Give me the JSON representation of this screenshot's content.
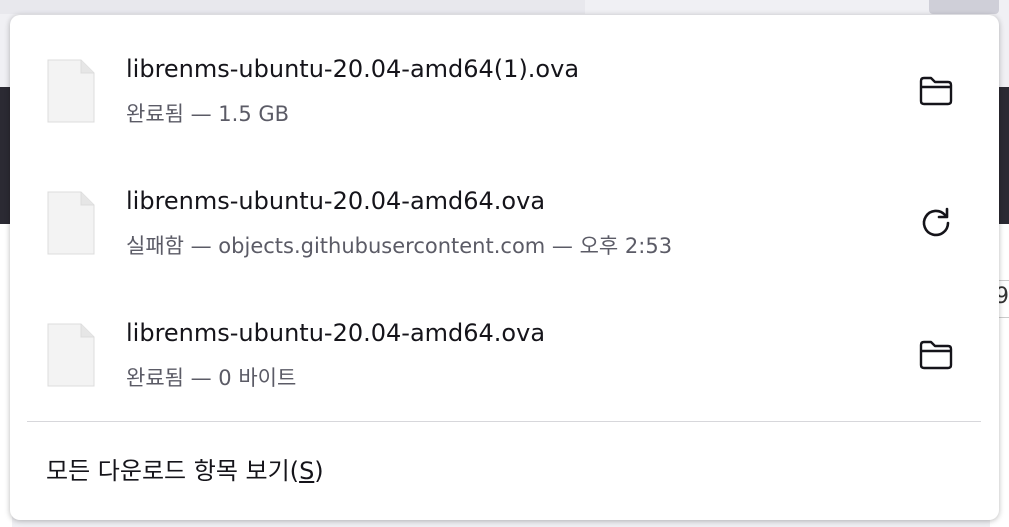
{
  "downloads": {
    "items": [
      {
        "filename": "librenms-ubuntu-20.04-amd64(1).ova",
        "status": "완료됨 — 1.5 GB",
        "action_icon": "folder-icon"
      },
      {
        "filename": "librenms-ubuntu-20.04-amd64.ova",
        "status": "실패함 — objects.githubusercontent.com — 오후 2:53",
        "action_icon": "retry-icon"
      },
      {
        "filename": "librenms-ubuntu-20.04-amd64.ova",
        "status": "완료됨 — 0 바이트",
        "action_icon": "folder-icon"
      }
    ],
    "show_all_label": "모든 다운로드 항목 보기(",
    "show_all_accel": "S",
    "show_all_suffix": ")"
  },
  "background": {
    "right_edge_digit": "9"
  }
}
